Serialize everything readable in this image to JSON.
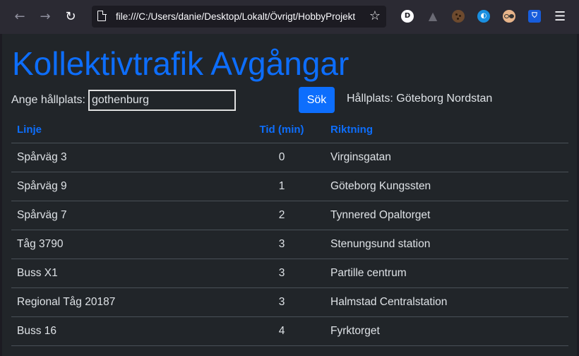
{
  "browser": {
    "url": "file:///C:/Users/danie/Desktop/Lokalt/Övrigt/HobbyProjekt"
  },
  "page": {
    "title": "Kollektivtrafik Avgångar",
    "stop_label": "Ange hållplats:",
    "stop_input_value": "gothenburg",
    "search_button": "Sök",
    "current_stop": "Hållplats: Göteborg Nordstan"
  },
  "table": {
    "headers": [
      "Linje",
      "Tid (min)",
      "Riktning"
    ],
    "rows": [
      {
        "line": "Spårväg 3",
        "time": "0",
        "direction": "Virginsgatan"
      },
      {
        "line": "Spårväg 9",
        "time": "1",
        "direction": "Göteborg Kungssten"
      },
      {
        "line": "Spårväg 7",
        "time": "2",
        "direction": "Tynnered Opaltorget"
      },
      {
        "line": "Tåg 3790",
        "time": "3",
        "direction": "Stenungsund station"
      },
      {
        "line": "Buss X1",
        "time": "3",
        "direction": "Partille centrum"
      },
      {
        "line": "Regional Tåg 20187",
        "time": "3",
        "direction": "Halmstad Centralstation"
      },
      {
        "line": "Buss 16",
        "time": "4",
        "direction": "Fyrktorget"
      }
    ]
  },
  "colors": {
    "accent": "#0d6efd",
    "page_background": "#212529",
    "chrome_background": "#2b2a33"
  }
}
